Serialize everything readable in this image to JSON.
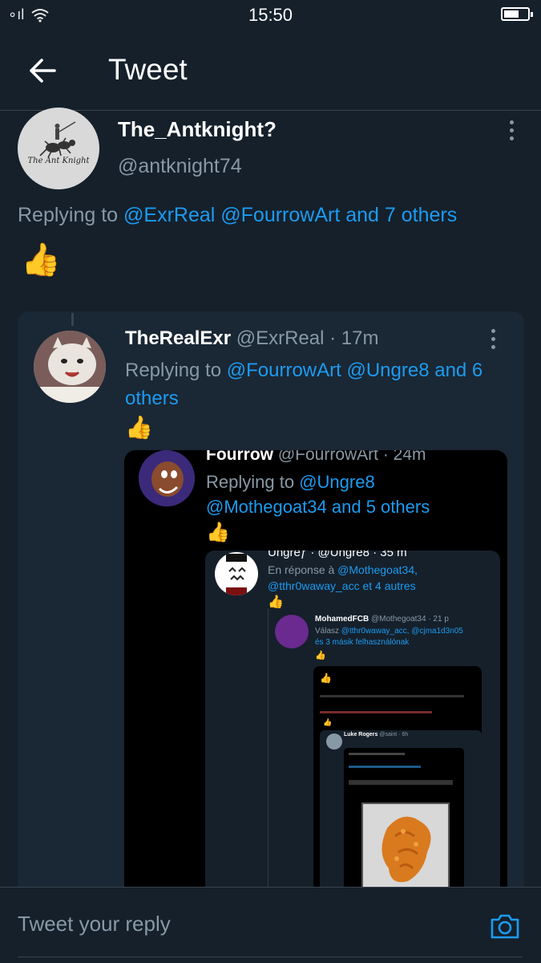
{
  "status_bar": {
    "signal": "∘ıl",
    "time": "15:50"
  },
  "header": {
    "title": "Tweet"
  },
  "main_tweet": {
    "name": "The_Antknight?",
    "handle": "@antknight74",
    "avatar_text": "The Ant Knight",
    "replying_prefix": "Replying to ",
    "replying_mentions": "@ExrReal @FourrowArt and 7 others",
    "content_emoji": "👍"
  },
  "quoted": {
    "name": "TheRealExr",
    "handle": "@ExrReal · 17m",
    "replying_prefix": "Replying to ",
    "replying_mentions": "@FourrowArt @Ungre8 and 6 others",
    "content_emoji": "👍",
    "nested": {
      "name": "Fourrow",
      "handle": "@FourrowArt · 24m",
      "replying_prefix": "Replying to ",
      "replying_mentions": "@Ungre8 @Mothegoat34 and 5 others",
      "content_emoji": "👍",
      "nested": {
        "header": "Ungreƒ · @Ungre8 · 35 m",
        "replying_prefix": "En réponse à ",
        "replying_mentions": "@Mothegoat34, @tthr0waway_acc et 4 autres",
        "content_emoji": "👍",
        "nested": {
          "name": "MohamedFCB",
          "handle": "@Mothegoat34 · 21 p",
          "replying_prefix": "Válasz ",
          "replying_mentions": "@tthr0waway_acc, @cjma1d3n05",
          "replying_suffix": "és 3 másik felhasználónak",
          "content_emoji": "👍",
          "deep_name": "Luke Rogers",
          "deep_handle": "@saint · 6h"
        }
      }
    }
  },
  "footer": {
    "reply_placeholder": "Tweet your reply"
  },
  "colors": {
    "background": "#15202b",
    "accent": "#1d9bf0",
    "muted": "#8899a6"
  },
  "icons": [
    "back-arrow-icon",
    "more-vertical-icon",
    "camera-icon",
    "wifi-icon",
    "battery-icon"
  ]
}
